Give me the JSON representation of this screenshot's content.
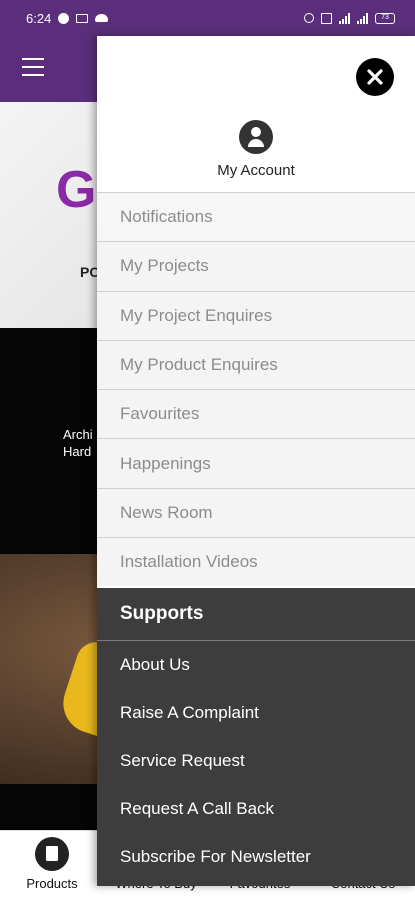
{
  "status_bar": {
    "time": "6:24",
    "battery": "73"
  },
  "background": {
    "brand_partial": "GI",
    "sub_partial": "PO",
    "band_text_line1": "Archi",
    "band_text_line2": "Hard"
  },
  "drawer": {
    "account_label": "My Account",
    "menu_items": [
      "Notifications",
      "My Projects",
      "My Project Enquires",
      "My Product Enquires",
      "Favourites",
      "Happenings",
      "News Room",
      "Installation Videos"
    ],
    "supports": {
      "title": "Supports",
      "items": [
        "About Us",
        "Raise A Complaint",
        "Service Request",
        "Request A Call Back",
        "Subscribe For Newsletter"
      ]
    }
  },
  "bottom_nav": {
    "items": [
      {
        "label": "Products",
        "icon": "products-icon"
      },
      {
        "label": "Where To Buy",
        "icon": "location-icon"
      },
      {
        "label": "Favourites",
        "icon": "heart-icon"
      },
      {
        "label": "Contact Us",
        "icon": "phone-icon"
      }
    ]
  },
  "colors": {
    "header": "#5a2e7a",
    "brand": "#8b2aa6",
    "supports_bg": "#3d3d3d",
    "menu_bg": "#f4f4f4",
    "menu_text": "#8c8c8c"
  }
}
